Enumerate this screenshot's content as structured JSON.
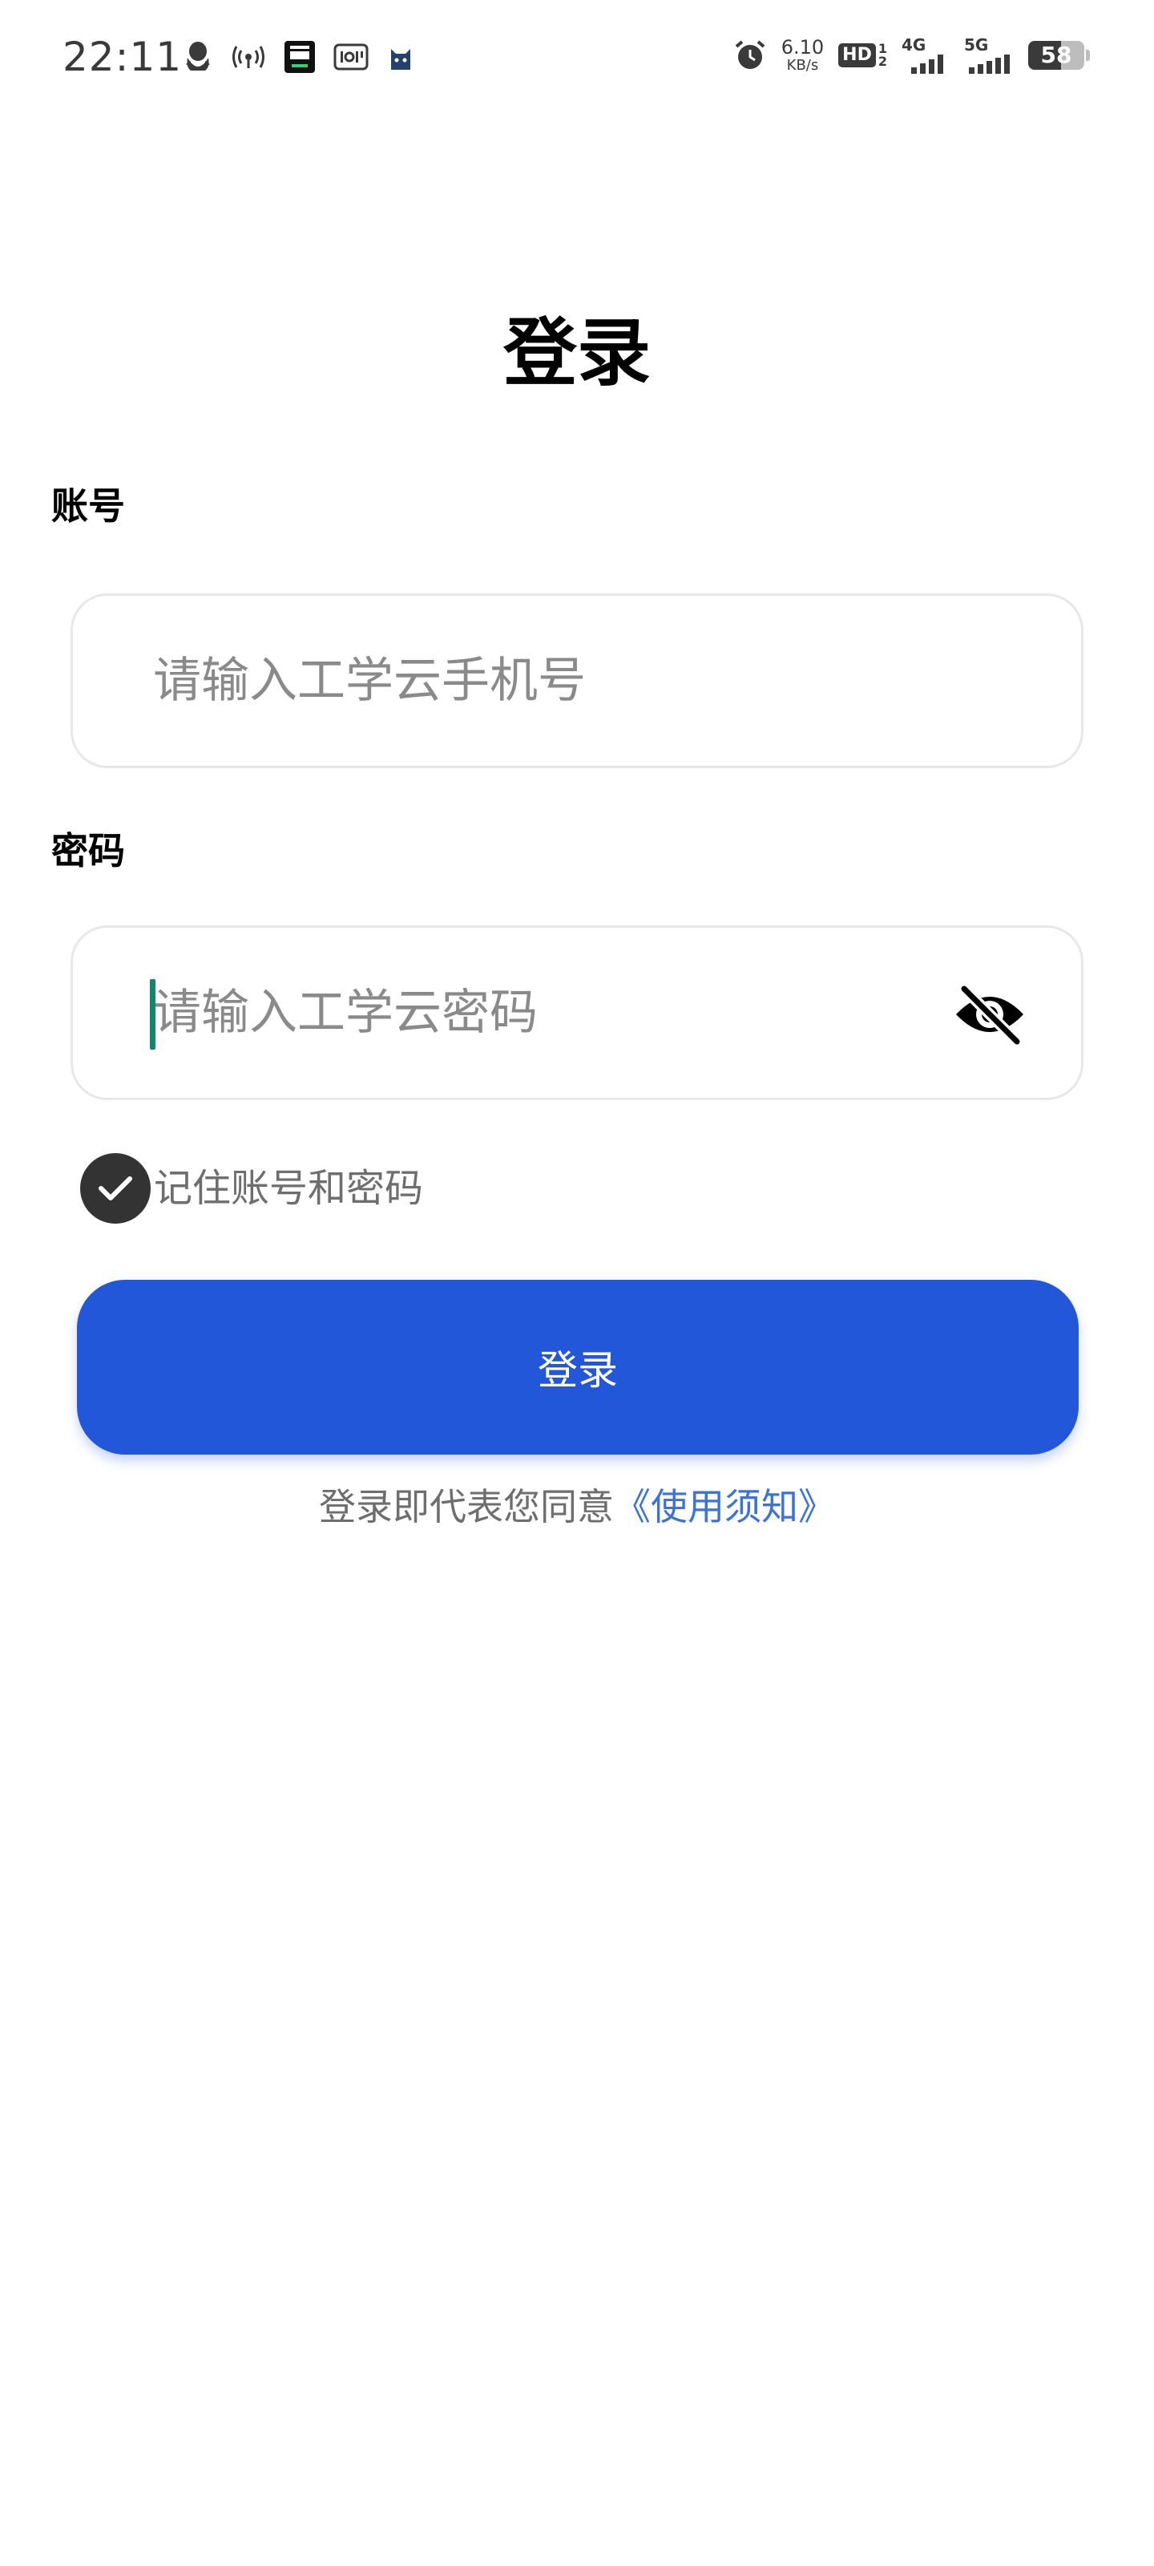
{
  "status_bar": {
    "time": "22:11",
    "net_speed_value": "6.10",
    "net_speed_unit": "KB/s",
    "hd_label": "HD",
    "hd_sub_top": "1",
    "hd_sub_bottom": "2",
    "signal_1_label": "4G",
    "signal_2_label": "5G",
    "battery_level": 58,
    "battery_text": "58",
    "left_icons": [
      "qq-icon",
      "hotspot-icon",
      "app-icon",
      "iqiyi-icon",
      "cat-app-icon"
    ],
    "right_icons": [
      "alarm-icon",
      "net-speed",
      "hd-icon",
      "signal-4g-icon",
      "signal-5g-icon",
      "battery-icon"
    ]
  },
  "page": {
    "title": "登录"
  },
  "account": {
    "label": "账号",
    "placeholder": "请输入工学云手机号",
    "value": ""
  },
  "password": {
    "label": "密码",
    "placeholder": "请输入工学云密码",
    "value": "",
    "toggle_icon": "eye-off-icon"
  },
  "remember": {
    "label": "记住账号和密码",
    "checked": true
  },
  "login_button": {
    "label": "登录"
  },
  "agreement": {
    "text": "登录即代表您同意",
    "link_text": "《使用须知》"
  },
  "colors": {
    "primary": "#2357d9",
    "link": "#3b73d8",
    "caret": "#0e8a6a",
    "checkbox": "#333333",
    "placeholder": "#8a8a8a"
  }
}
